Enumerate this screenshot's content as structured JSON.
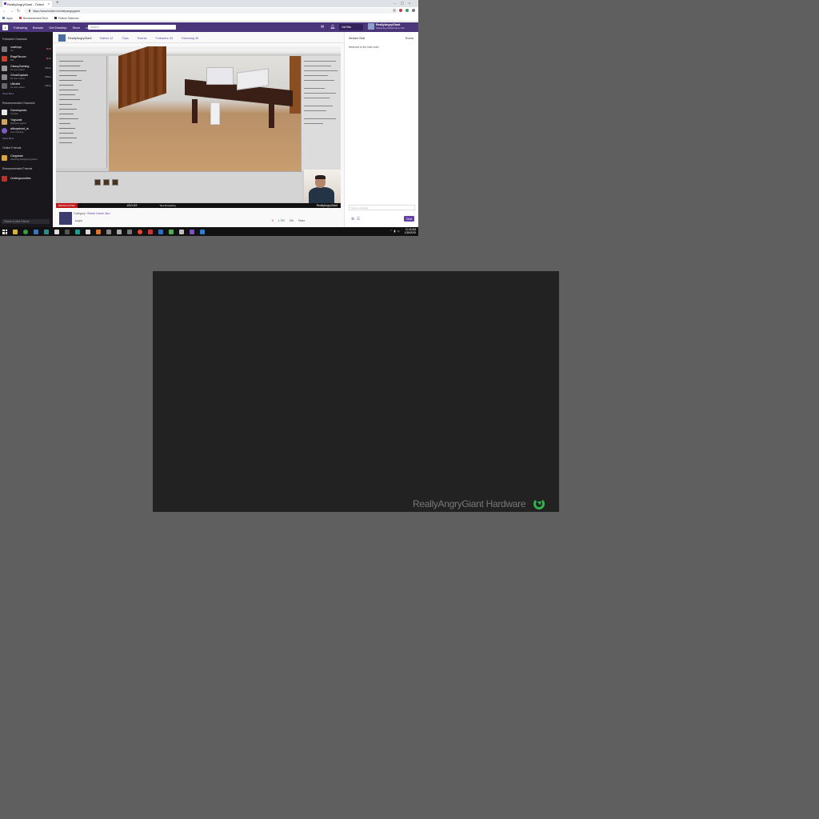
{
  "browser": {
    "tab_title": "ReallyAngryGiant - Twitch",
    "url": "https://www.twitch.tv/reallyangrygiant",
    "bookmarks": [
      "Apps",
      "Recommended Tech",
      "Pollock Sciences"
    ]
  },
  "twitch_nav": {
    "links": [
      "Following",
      "Browse",
      "Get Desktop",
      "Store"
    ],
    "more": "•••",
    "search_placeholder": "Search",
    "get_bits": "Get Bits",
    "user_name": "ReallyAngryGiant",
    "user_status": "Streaming Global Game Jam"
  },
  "sidebar": {
    "followed_header": "Followed Channels",
    "followed": [
      {
        "name": "cowboys",
        "sub": "Art",
        "right": "1.2K"
      },
      {
        "name": "RageTaroon",
        "sub": "IRL",
        "right": "1.1K"
      },
      {
        "name": "ClassyGaming",
        "sub": "10 new videos",
        "right": "Offline"
      },
      {
        "name": "GhostCaptain",
        "sub": "18 new videos",
        "right": "Offline"
      },
      {
        "name": "Uiltrabit",
        "sub": "10 new videos",
        "right": "Offline"
      }
    ],
    "followed_more": "Show More",
    "recommended_header": "Recommended Channels",
    "recommended": [
      {
        "name": "Gamespecta",
        "sub": "Fortnite"
      },
      {
        "name": "Yogscast",
        "sub": "Darkest Legend"
      },
      {
        "name": "allboyskmd_ts",
        "sub": "Just Chatting"
      }
    ],
    "recommended_more": "Show More",
    "online_header": "Online Friends",
    "online": [
      {
        "name": "Cargostar",
        "sub": "watching ReallyAngryGiant"
      }
    ],
    "rec_friends_header": "Recommended Friends",
    "rec_friends": [
      {
        "name": "Undergroundies"
      }
    ],
    "friend_search": "Search to Add Friends"
  },
  "channel": {
    "name": "ReallyAngryGiant",
    "tabs": [
      "Videos 12",
      "Clips",
      "Events",
      "Followers 43",
      "Following 30"
    ],
    "category_label": "Category:",
    "category": "Global Game Jam",
    "language": "English",
    "stats": {
      "viewers": "6",
      "views": "1,793",
      "bits": "Gift",
      "share": "Share"
    }
  },
  "stream_overlay": {
    "live_tag": "BROADCASTING",
    "hashtag": "#GGJ19",
    "timer": "Time Remaining",
    "channel_tag": "ReallyAngryGiant"
  },
  "chat": {
    "header": "Stream Chat",
    "rooms": "Rooms",
    "welcome": "Welcome to the chat room!",
    "placeholder": "Send a message",
    "send": "Chat"
  },
  "taskbar": {
    "time": "11:43 AM",
    "date": "1/26/2019"
  },
  "watermark": {
    "text": "ReallyAngryGiant Hardware"
  },
  "colors": {
    "twitch_purple": "#6441a4",
    "nav_purple": "#4b367c",
    "sidebar_bg": "#19171c",
    "outer_bg": "#5f5f5f",
    "video_bg": "#222222",
    "watermark_icon": "#2fb34a"
  }
}
